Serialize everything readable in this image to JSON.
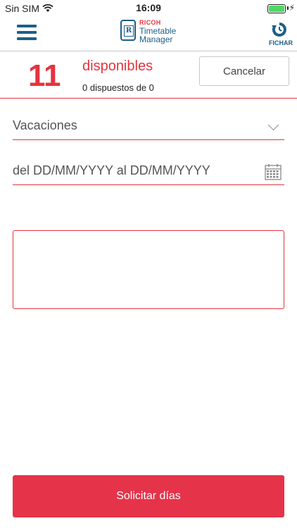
{
  "status_bar": {
    "carrier": "Sin SIM",
    "time": "16:09"
  },
  "navbar": {
    "logo_brand": "RICOH",
    "logo_line1": "Timetable",
    "logo_line2": "Manager",
    "logo_letter": "R",
    "clock_in_label": "FICHAR"
  },
  "summary": {
    "available_count": "11",
    "available_label": "disponibles",
    "used_text": "0 dispuestos de 0",
    "cancel_label": "Cancelar"
  },
  "form": {
    "type_value": "Vacaciones",
    "date_placeholder": "del DD/MM/YYYY al DD/MM/YYYY",
    "comments_value": ""
  },
  "submit_label": "Solicitar días",
  "colors": {
    "accent": "#e5333f",
    "brand_blue": "#1d5f86",
    "button": "#e5334a"
  }
}
